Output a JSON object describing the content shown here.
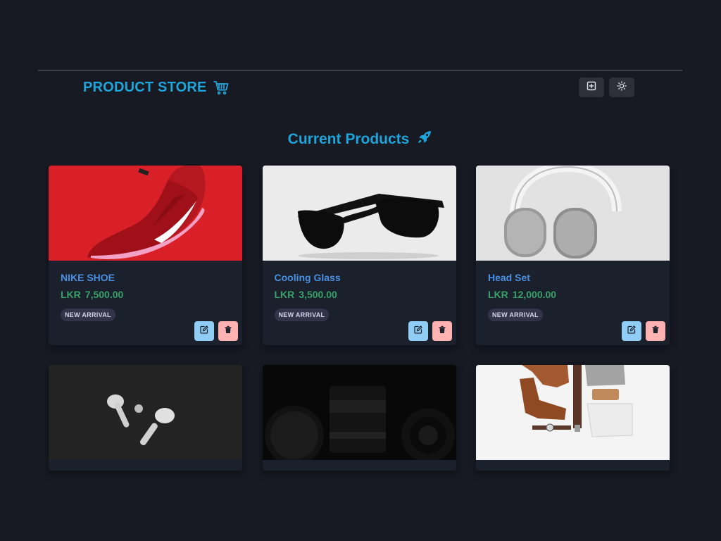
{
  "header": {
    "title": "PRODUCT STORE",
    "cart_icon": "shopping-cart-icon",
    "create_icon": "plus-square-icon",
    "theme_icon": "sun-icon"
  },
  "main": {
    "section_title": "Current Products",
    "section_icon": "rocket-icon"
  },
  "products": [
    {
      "name": "NIKE SHOE",
      "currency": "LKR",
      "price": "7,500.00",
      "badge": "NEW ARRIVAL",
      "image": "red-sneaker-photo"
    },
    {
      "name": "Cooling Glass",
      "currency": "LKR",
      "price": "3,500.00",
      "badge": "NEW ARRIVAL",
      "image": "black-sunglasses-photo"
    },
    {
      "name": "Head Set",
      "currency": "LKR",
      "price": "12,000.00",
      "badge": "NEW ARRIVAL",
      "image": "silver-headphones-photo"
    },
    {
      "image": "wireless-earbuds-photo"
    },
    {
      "image": "canon-camera-lenses-photo"
    },
    {
      "image": "boots-and-apparel-flatlay-photo"
    }
  ],
  "colors": {
    "background": "#171923",
    "card": "#1a202c",
    "accent": "#1fa5d9",
    "product_name": "#4a90e2",
    "price": "#38a169",
    "edit": "#90cdf4",
    "delete": "#feb2b2"
  }
}
